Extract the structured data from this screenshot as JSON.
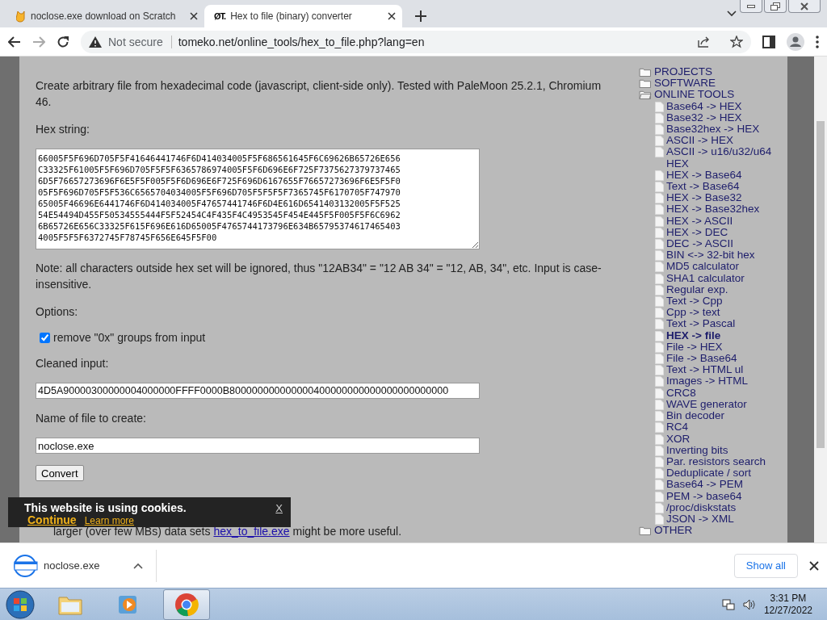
{
  "browser": {
    "tabs": [
      {
        "title": "noclose.exe download on Scratch",
        "selected": false
      },
      {
        "title": "Hex to file (binary) converter",
        "favicon_text": "ØT.",
        "selected": true
      }
    ],
    "address": {
      "security": "Not secure",
      "url": "tomeko.net/online_tools/hex_to_file.php?lang=en"
    }
  },
  "page": {
    "intro": "Create arbitrary file from hexadecimal code (javascript, client-side only). Tested with PaleMoon 25.2.1, Chromium 46.",
    "hex_label": "Hex string:",
    "hex_lines": [
      "66005F5F696D705F5F41646441746F6D414034005F5F686561645F6C69626B65726E656",
      "C33325F61005F5F696D705F5F5F6365786974005F5F6D696E6F725F7375627379737465",
      "6D5F76657273696F6E5F5F005F5F6D696E6F725F696D6167655F76657273696F6E5F5F0",
      "05F5F696D705F5F536C6565704034005F5F696D705F5F5F5F7365745F6170705F747970",
      "65005F46696E6441746F6D414034005F47657441746F6D4E616D6541403132005F5F525",
      "54E54494D455F50534555444F5F52454C4F435F4C4953545F454E445F5F005F5F6C6962",
      "6B65726E656C33325F615F696E616D65005F4765744173796E634B65795374617465403",
      "4005F5F5F6372745F78745F656E645F5F00"
    ],
    "note": "Note: all characters outside hex set will be ignored, thus \"12AB34\" = \"12 AB 34\" = \"12, AB, 34\", etc. Input is case-insensitive.",
    "options_label": "Options:",
    "option": {
      "label": "remove \"0x\" groups from input",
      "checked": true
    },
    "cleaned_label": "Cleaned input:",
    "cleaned_value": "4D5A90000300000004000000FFFF0000B800000000000000400000000000000000000000",
    "name_label": "Name of file to create:",
    "name_value": "noclose.exe",
    "convert": "Convert",
    "footer_text": "larger (over few MBs) data sets",
    "footer_link": "hex_to_file.exe",
    "footer_tail": "might be more useful."
  },
  "sidebar": {
    "items": [
      {
        "label": "PROJECTS",
        "expanded": false
      },
      {
        "label": "SOFTWARE",
        "expanded": false
      },
      {
        "label": "ONLINE TOOLS",
        "expanded": true,
        "children": [
          {
            "label": "Base64 -> HEX",
            "selected": false
          },
          {
            "label": "Base32 -> HEX",
            "selected": false
          },
          {
            "label": "Base32hex -> HEX",
            "selected": false
          },
          {
            "label": "ASCII -> HEX",
            "selected": false
          },
          {
            "label": "ASCII -> u16/u32/u64 HEX",
            "selected": false
          },
          {
            "label": "HEX -> Base64",
            "selected": false
          },
          {
            "label": "Text -> Base64",
            "selected": false
          },
          {
            "label": "HEX -> Base32",
            "selected": false
          },
          {
            "label": "HEX -> Base32hex",
            "selected": false
          },
          {
            "label": "HEX -> ASCII",
            "selected": false
          },
          {
            "label": "HEX -> DEC",
            "selected": false
          },
          {
            "label": "DEC -> ASCII",
            "selected": false
          },
          {
            "label": "BIN <-> 32-bit hex",
            "selected": false
          },
          {
            "label": "MD5 calculator",
            "selected": false
          },
          {
            "label": "SHA1 calculator",
            "selected": false
          },
          {
            "label": "Regular exp.",
            "selected": false
          },
          {
            "label": "Text -> Cpp",
            "selected": false
          },
          {
            "label": "Cpp -> text",
            "selected": false
          },
          {
            "label": "Text -> Pascal",
            "selected": false
          },
          {
            "label": "HEX -> file",
            "selected": true
          },
          {
            "label": "File -> HEX",
            "selected": false
          },
          {
            "label": "File -> Base64",
            "selected": false
          },
          {
            "label": "Text -> HTML ul",
            "selected": false
          },
          {
            "label": "Images -> HTML",
            "selected": false
          },
          {
            "label": "CRC8",
            "selected": false
          },
          {
            "label": "WAVE generator",
            "selected": false
          },
          {
            "label": "Bin decoder",
            "selected": false
          },
          {
            "label": "RC4",
            "selected": false
          },
          {
            "label": "XOR",
            "selected": false
          },
          {
            "label": "Inverting bits",
            "selected": false
          },
          {
            "label": "Par. resistors search",
            "selected": false
          },
          {
            "label": "Deduplicate / sort",
            "selected": false
          },
          {
            "label": "Base64 -> PEM",
            "selected": false
          },
          {
            "label": "PEM -> base64",
            "selected": false
          },
          {
            "label": "/proc/diskstats",
            "selected": false
          },
          {
            "label": "JSON -> XML",
            "selected": false
          }
        ]
      },
      {
        "label": "OTHER",
        "expanded": false
      }
    ]
  },
  "cookie_banner": {
    "text": "This website is using cookies.",
    "close": "X",
    "continue": "Continue",
    "learn_more": "Learn more"
  },
  "download_shelf": {
    "file": "noclose.exe",
    "show_all": "Show all"
  },
  "taskbar": {
    "time": "3:31 PM",
    "date": "12/27/2022"
  }
}
